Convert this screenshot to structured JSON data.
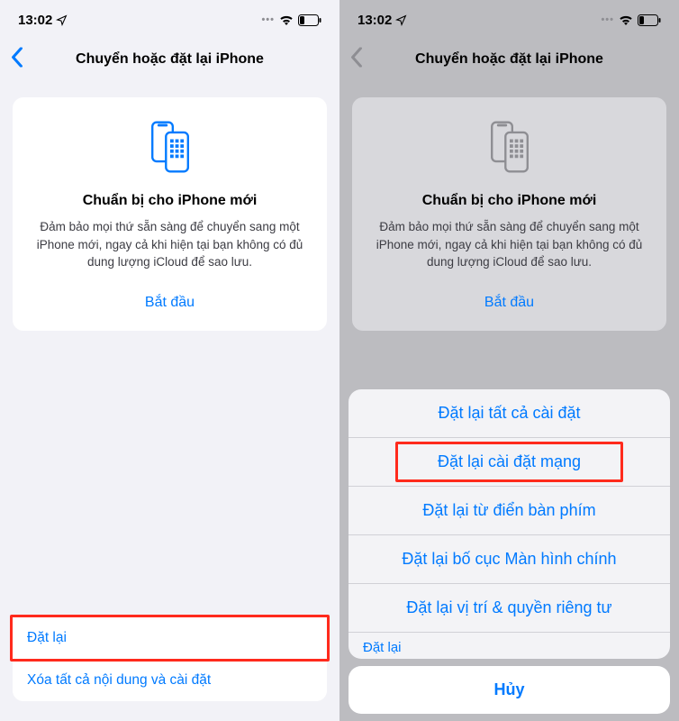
{
  "status": {
    "time": "13:02",
    "location_icon": "location-arrow",
    "wifi_icon": "wifi",
    "battery_icon": "battery-low"
  },
  "nav": {
    "title": "Chuyển hoặc đặt lại iPhone"
  },
  "prepare_card": {
    "title": "Chuẩn bị cho iPhone mới",
    "description": "Đảm bảo mọi thứ sẵn sàng để chuyển sang một iPhone mới, ngay cả khi hiện tại bạn không có đủ dung lượng iCloud để sao lưu.",
    "start_label": "Bắt đầu"
  },
  "bottom_actions": {
    "reset": "Đặt lại",
    "erase_all": "Xóa tất cả nội dung và cài đặt"
  },
  "action_sheet": {
    "items": [
      "Đặt lại tất cả cài đặt",
      "Đặt lại cài đặt mạng",
      "Đặt lại từ điển bàn phím",
      "Đặt lại bố cục Màn hình chính",
      "Đặt lại vị trí & quyền riêng tư"
    ],
    "partial_above": "Đặt lại",
    "cancel": "Hủy"
  }
}
